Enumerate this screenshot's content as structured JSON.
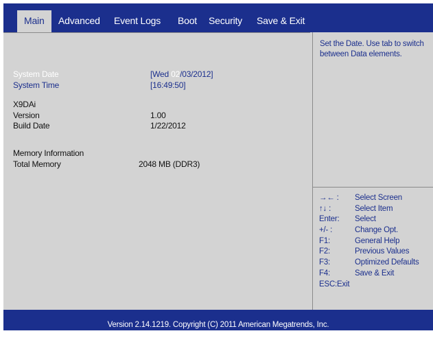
{
  "tabs": [
    {
      "label": "Main"
    },
    {
      "label": "Advanced"
    },
    {
      "label": "Event Logs"
    },
    {
      "label": "Boot"
    },
    {
      "label": "Security"
    },
    {
      "label": "Save & Exit"
    }
  ],
  "main": {
    "system_date": {
      "label": "System Date",
      "value_prefix": "[Wed ",
      "value_highlight": "02",
      "value_suffix": "/03/2012]"
    },
    "system_time": {
      "label": "System Time",
      "value": "[16:49:50]"
    },
    "board": "X9DAi",
    "version": {
      "label": "Version",
      "value": "1.00"
    },
    "build_date": {
      "label": "Build Date",
      "value": "1/22/2012"
    },
    "memory_header": "Memory Information",
    "total_memory": {
      "label": "Total Memory",
      "value": "2048 MB (DDR3)"
    }
  },
  "help": {
    "text": "Set the Date.  Use tab to switch between Data elements."
  },
  "keys": [
    {
      "key": "→← :",
      "desc": "Select Screen"
    },
    {
      "key": "↑↓ :",
      "desc": "Select Item"
    },
    {
      "key": "Enter:",
      "desc": "Select"
    },
    {
      "key": "+/- :",
      "desc": "Change Opt."
    },
    {
      "key": "F1:",
      "desc": "General Help"
    },
    {
      "key": "F2:",
      "desc": "Previous Values"
    },
    {
      "key": "F3:",
      "desc": "Optimized Defaults"
    },
    {
      "key": "F4:",
      "desc": "Save & Exit"
    },
    {
      "key": "ESC:Exit",
      "desc": ""
    }
  ],
  "footer": "Version 2.14.1219. Copyright (C) 2011 American Megatrends, Inc.",
  "colors": {
    "background_blue": "#1b2f8d",
    "panel_gray": "#d3d3d3",
    "highlight_white": "#ffffff"
  }
}
